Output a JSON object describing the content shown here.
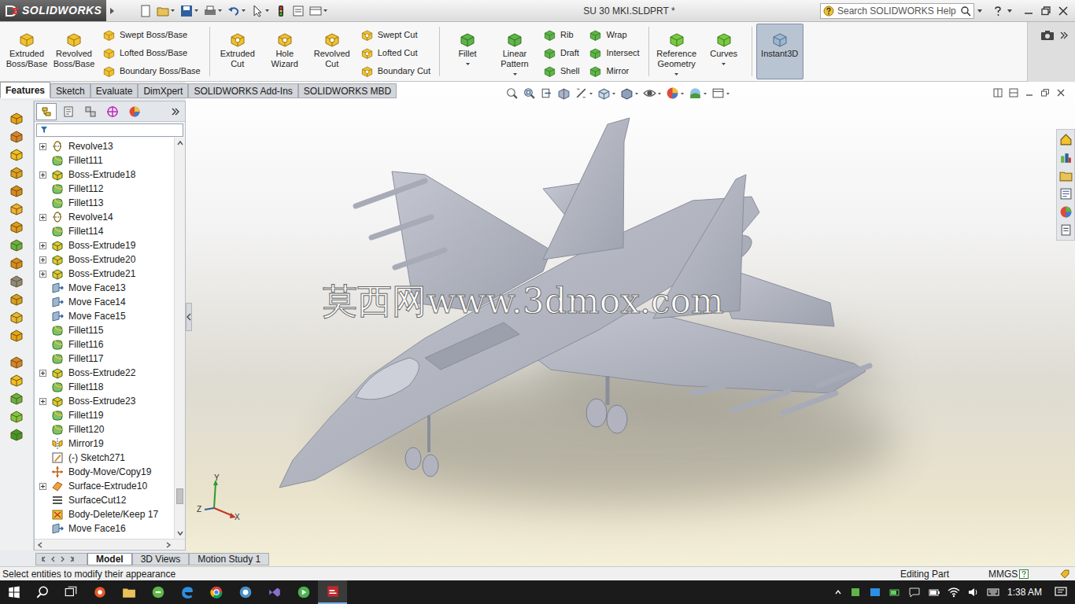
{
  "app": {
    "name": "SOLIDWORKS"
  },
  "window": {
    "title": "SU 30 MKI.SLDPRT *"
  },
  "search": {
    "placeholder": "Search SOLIDWORKS Help"
  },
  "ribbon": [
    {
      "kind": "large",
      "label": "Extruded Boss/Base",
      "selected": false,
      "dropdown": false
    },
    {
      "kind": "large",
      "label": "Revolved Boss/Base",
      "selected": false,
      "dropdown": false
    },
    {
      "kind": "stack",
      "items": [
        {
          "label": "Swept Boss/Base",
          "selected": false
        },
        {
          "label": "Lofted Boss/Base",
          "selected": false
        },
        {
          "label": "Boundary Boss/Base",
          "selected": false
        }
      ]
    },
    {
      "kind": "separator"
    },
    {
      "kind": "large",
      "label": "Extruded Cut",
      "selected": false,
      "dropdown": false
    },
    {
      "kind": "large",
      "label": "Hole Wizard",
      "selected": false,
      "dropdown": false
    },
    {
      "kind": "large",
      "label": "Revolved Cut",
      "selected": false,
      "dropdown": false
    },
    {
      "kind": "stack",
      "items": [
        {
          "label": "Swept Cut",
          "selected": false
        },
        {
          "label": "Lofted Cut",
          "selected": false
        },
        {
          "label": "Boundary Cut",
          "selected": false
        }
      ]
    },
    {
      "kind": "separator"
    },
    {
      "kind": "large",
      "label": "Fillet",
      "selected": false,
      "dropdown": true
    },
    {
      "kind": "large",
      "label": "Linear Pattern",
      "selected": false,
      "dropdown": true
    },
    {
      "kind": "stack",
      "items": [
        {
          "label": "Rib",
          "selected": false
        },
        {
          "label": "Draft",
          "selected": false
        },
        {
          "label": "Shell",
          "selected": false
        }
      ]
    },
    {
      "kind": "stack",
      "items": [
        {
          "label": "Wrap",
          "selected": false
        },
        {
          "label": "Intersect",
          "selected": false
        },
        {
          "label": "Mirror",
          "selected": false
        }
      ]
    },
    {
      "kind": "separator"
    },
    {
      "kind": "large",
      "label": "Reference Geometry",
      "selected": false,
      "dropdown": true
    },
    {
      "kind": "large",
      "label": "Curves",
      "selected": false,
      "dropdown": true
    },
    {
      "kind": "separator"
    },
    {
      "kind": "large",
      "label": "Instant3D",
      "selected": true,
      "dropdown": false
    }
  ],
  "tabs": [
    {
      "label": "Features",
      "selected": true
    },
    {
      "label": "Sketch",
      "selected": false
    },
    {
      "label": "Evaluate",
      "selected": false
    },
    {
      "label": "DimXpert",
      "selected": false
    },
    {
      "label": "SOLIDWORKS Add-Ins",
      "selected": false
    },
    {
      "label": "SOLIDWORKS MBD",
      "selected": false
    }
  ],
  "tree": {
    "scroll_level": 0.93,
    "items": [
      {
        "label": "Revolve13",
        "kind": "revolve",
        "expandable": true
      },
      {
        "label": "Fillet111",
        "kind": "fillet",
        "expandable": false
      },
      {
        "label": "Boss-Extrude18",
        "kind": "extrude",
        "expandable": true
      },
      {
        "label": "Fillet112",
        "kind": "fillet",
        "expandable": false
      },
      {
        "label": "Fillet113",
        "kind": "fillet",
        "expandable": false
      },
      {
        "label": "Revolve14",
        "kind": "revolve",
        "expandable": true
      },
      {
        "label": "Fillet114",
        "kind": "fillet",
        "expandable": false
      },
      {
        "label": "Boss-Extrude19",
        "kind": "extrude",
        "expandable": true
      },
      {
        "label": "Boss-Extrude20",
        "kind": "extrude",
        "expandable": true
      },
      {
        "label": "Boss-Extrude21",
        "kind": "extrude",
        "expandable": true
      },
      {
        "label": "Move Face13",
        "kind": "move-face",
        "expandable": false
      },
      {
        "label": "Move Face14",
        "kind": "move-face",
        "expandable": false
      },
      {
        "label": "Move Face15",
        "kind": "move-face",
        "expandable": false
      },
      {
        "label": "Fillet115",
        "kind": "fillet",
        "expandable": false
      },
      {
        "label": "Fillet116",
        "kind": "fillet",
        "expandable": false
      },
      {
        "label": "Fillet117",
        "kind": "fillet",
        "expandable": false
      },
      {
        "label": "Boss-Extrude22",
        "kind": "extrude",
        "expandable": true
      },
      {
        "label": "Fillet118",
        "kind": "fillet",
        "expandable": false
      },
      {
        "label": "Boss-Extrude23",
        "kind": "extrude",
        "expandable": true
      },
      {
        "label": "Fillet119",
        "kind": "fillet",
        "expandable": false
      },
      {
        "label": "Fillet120",
        "kind": "fillet",
        "expandable": false
      },
      {
        "label": "Mirror19",
        "kind": "mirror",
        "expandable": false
      },
      {
        "label": "(-) Sketch271",
        "kind": "sketch",
        "expandable": false
      },
      {
        "label": "Body-Move/Copy19",
        "kind": "body-move",
        "expandable": false
      },
      {
        "label": "Surface-Extrude10",
        "kind": "surface-extrude",
        "expandable": true
      },
      {
        "label": "SurfaceCut12",
        "kind": "surface-cut",
        "expandable": false
      },
      {
        "label": "Body-Delete/Keep 17",
        "kind": "body-delete",
        "expandable": false
      },
      {
        "label": "Move Face16",
        "kind": "move-face",
        "expandable": false
      }
    ]
  },
  "bottom_tabs": [
    {
      "label": "Model",
      "selected": true
    },
    {
      "label": "3D Views",
      "selected": false
    },
    {
      "label": "Motion Study 1",
      "selected": false
    }
  ],
  "viewport": {
    "watermark": "莫西网www.3dmox.com",
    "axes": [
      "Y",
      "Z",
      "X"
    ]
  },
  "status_bar": {
    "message": "Select entities to modify their appearance",
    "mode": "Editing Part",
    "units": "MMGS"
  },
  "taskbar": {
    "time": "1:38 AM"
  }
}
